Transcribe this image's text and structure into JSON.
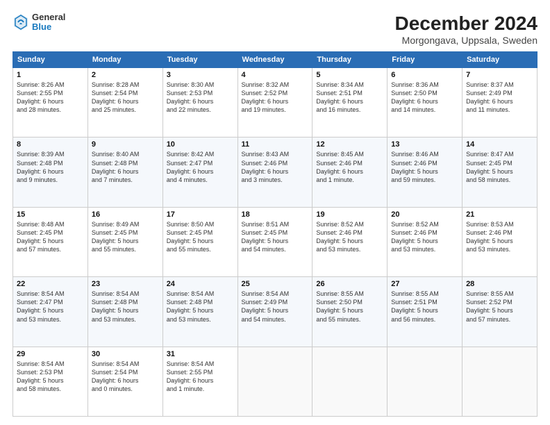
{
  "logo": {
    "general": "General",
    "blue": "Blue"
  },
  "title": "December 2024",
  "location": "Morgongava, Uppsala, Sweden",
  "days_of_week": [
    "Sunday",
    "Monday",
    "Tuesday",
    "Wednesday",
    "Thursday",
    "Friday",
    "Saturday"
  ],
  "weeks": [
    [
      {
        "day": "1",
        "detail": "Sunrise: 8:26 AM\nSunset: 2:55 PM\nDaylight: 6 hours\nand 28 minutes."
      },
      {
        "day": "2",
        "detail": "Sunrise: 8:28 AM\nSunset: 2:54 PM\nDaylight: 6 hours\nand 25 minutes."
      },
      {
        "day": "3",
        "detail": "Sunrise: 8:30 AM\nSunset: 2:53 PM\nDaylight: 6 hours\nand 22 minutes."
      },
      {
        "day": "4",
        "detail": "Sunrise: 8:32 AM\nSunset: 2:52 PM\nDaylight: 6 hours\nand 19 minutes."
      },
      {
        "day": "5",
        "detail": "Sunrise: 8:34 AM\nSunset: 2:51 PM\nDaylight: 6 hours\nand 16 minutes."
      },
      {
        "day": "6",
        "detail": "Sunrise: 8:36 AM\nSunset: 2:50 PM\nDaylight: 6 hours\nand 14 minutes."
      },
      {
        "day": "7",
        "detail": "Sunrise: 8:37 AM\nSunset: 2:49 PM\nDaylight: 6 hours\nand 11 minutes."
      }
    ],
    [
      {
        "day": "8",
        "detail": "Sunrise: 8:39 AM\nSunset: 2:48 PM\nDaylight: 6 hours\nand 9 minutes."
      },
      {
        "day": "9",
        "detail": "Sunrise: 8:40 AM\nSunset: 2:48 PM\nDaylight: 6 hours\nand 7 minutes."
      },
      {
        "day": "10",
        "detail": "Sunrise: 8:42 AM\nSunset: 2:47 PM\nDaylight: 6 hours\nand 4 minutes."
      },
      {
        "day": "11",
        "detail": "Sunrise: 8:43 AM\nSunset: 2:46 PM\nDaylight: 6 hours\nand 3 minutes."
      },
      {
        "day": "12",
        "detail": "Sunrise: 8:45 AM\nSunset: 2:46 PM\nDaylight: 6 hours\nand 1 minute."
      },
      {
        "day": "13",
        "detail": "Sunrise: 8:46 AM\nSunset: 2:46 PM\nDaylight: 5 hours\nand 59 minutes."
      },
      {
        "day": "14",
        "detail": "Sunrise: 8:47 AM\nSunset: 2:45 PM\nDaylight: 5 hours\nand 58 minutes."
      }
    ],
    [
      {
        "day": "15",
        "detail": "Sunrise: 8:48 AM\nSunset: 2:45 PM\nDaylight: 5 hours\nand 57 minutes."
      },
      {
        "day": "16",
        "detail": "Sunrise: 8:49 AM\nSunset: 2:45 PM\nDaylight: 5 hours\nand 55 minutes."
      },
      {
        "day": "17",
        "detail": "Sunrise: 8:50 AM\nSunset: 2:45 PM\nDaylight: 5 hours\nand 55 minutes."
      },
      {
        "day": "18",
        "detail": "Sunrise: 8:51 AM\nSunset: 2:45 PM\nDaylight: 5 hours\nand 54 minutes."
      },
      {
        "day": "19",
        "detail": "Sunrise: 8:52 AM\nSunset: 2:46 PM\nDaylight: 5 hours\nand 53 minutes."
      },
      {
        "day": "20",
        "detail": "Sunrise: 8:52 AM\nSunset: 2:46 PM\nDaylight: 5 hours\nand 53 minutes."
      },
      {
        "day": "21",
        "detail": "Sunrise: 8:53 AM\nSunset: 2:46 PM\nDaylight: 5 hours\nand 53 minutes."
      }
    ],
    [
      {
        "day": "22",
        "detail": "Sunrise: 8:54 AM\nSunset: 2:47 PM\nDaylight: 5 hours\nand 53 minutes."
      },
      {
        "day": "23",
        "detail": "Sunrise: 8:54 AM\nSunset: 2:48 PM\nDaylight: 5 hours\nand 53 minutes."
      },
      {
        "day": "24",
        "detail": "Sunrise: 8:54 AM\nSunset: 2:48 PM\nDaylight: 5 hours\nand 53 minutes."
      },
      {
        "day": "25",
        "detail": "Sunrise: 8:54 AM\nSunset: 2:49 PM\nDaylight: 5 hours\nand 54 minutes."
      },
      {
        "day": "26",
        "detail": "Sunrise: 8:55 AM\nSunset: 2:50 PM\nDaylight: 5 hours\nand 55 minutes."
      },
      {
        "day": "27",
        "detail": "Sunrise: 8:55 AM\nSunset: 2:51 PM\nDaylight: 5 hours\nand 56 minutes."
      },
      {
        "day": "28",
        "detail": "Sunrise: 8:55 AM\nSunset: 2:52 PM\nDaylight: 5 hours\nand 57 minutes."
      }
    ],
    [
      {
        "day": "29",
        "detail": "Sunrise: 8:54 AM\nSunset: 2:53 PM\nDaylight: 5 hours\nand 58 minutes."
      },
      {
        "day": "30",
        "detail": "Sunrise: 8:54 AM\nSunset: 2:54 PM\nDaylight: 6 hours\nand 0 minutes."
      },
      {
        "day": "31",
        "detail": "Sunrise: 8:54 AM\nSunset: 2:55 PM\nDaylight: 6 hours\nand 1 minute."
      },
      {
        "day": "",
        "detail": ""
      },
      {
        "day": "",
        "detail": ""
      },
      {
        "day": "",
        "detail": ""
      },
      {
        "day": "",
        "detail": ""
      }
    ]
  ]
}
